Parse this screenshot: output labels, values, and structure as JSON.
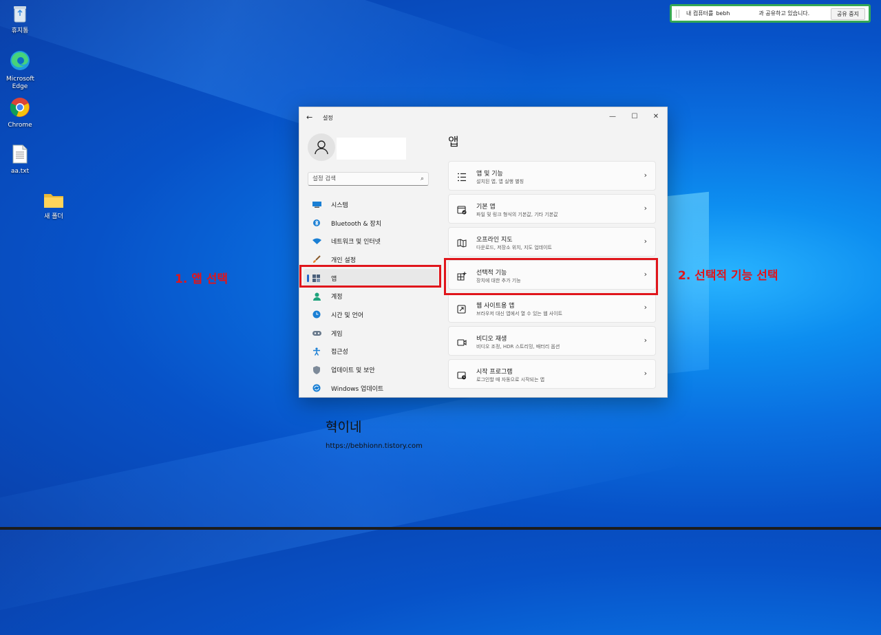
{
  "desktop": {
    "icons": [
      {
        "label": "휴지통",
        "icon": "recycle-bin-icon"
      },
      {
        "label": "Microsoft Edge",
        "icon": "edge-icon"
      },
      {
        "label": "Chrome",
        "icon": "chrome-icon"
      },
      {
        "label": "aa.txt",
        "icon": "text-file-icon"
      },
      {
        "label": "새 폴더",
        "icon": "folder-icon"
      }
    ]
  },
  "share_bar": {
    "prefix": "내 컴퓨터를",
    "user": "bebh",
    "suffix": "과 공유하고 있습니다.",
    "stop_label": "공유 중지"
  },
  "settings": {
    "window_title": "설정",
    "search_placeholder": "설정 검색",
    "nav": [
      {
        "label": "시스템",
        "icon": "monitor-icon"
      },
      {
        "label": "Bluetooth & 장치",
        "icon": "bluetooth-icon"
      },
      {
        "label": "네트워크 및 인터넷",
        "icon": "wifi-icon"
      },
      {
        "label": "개인 설정",
        "icon": "brush-icon"
      },
      {
        "label": "앱",
        "icon": "apps-icon"
      },
      {
        "label": "계정",
        "icon": "person-icon"
      },
      {
        "label": "시간 및 언어",
        "icon": "globe-clock-icon"
      },
      {
        "label": "게임",
        "icon": "gamepad-icon"
      },
      {
        "label": "접근성",
        "icon": "accessibility-icon"
      },
      {
        "label": "업데이트 및 보안",
        "icon": "shield-icon"
      },
      {
        "label": "Windows 업데이트",
        "icon": "update-icon"
      }
    ],
    "page_title": "앱",
    "cards": [
      {
        "title": "앱 및 기능",
        "subtitle": "설치된 앱, 앱 실행 별칭",
        "icon": "app-list-icon"
      },
      {
        "title": "기본 앱",
        "subtitle": "파일 및 링크 형식의 기본값, 기타 기본값",
        "icon": "default-apps-icon"
      },
      {
        "title": "오프라인 지도",
        "subtitle": "다운로드, 저장소 위치, 지도 업데이트",
        "icon": "map-icon"
      },
      {
        "title": "선택적 기능",
        "subtitle": "장치에 대한 추가 기능",
        "icon": "add-feature-icon"
      },
      {
        "title": "웹 사이트용 앱",
        "subtitle": "브라우저 대신 앱에서 열 수 있는 웹 사이트",
        "icon": "web-app-icon"
      },
      {
        "title": "비디오 재생",
        "subtitle": "비디오 조정, HDR 스트리밍, 배터리 옵션",
        "icon": "video-icon"
      },
      {
        "title": "시작 프로그램",
        "subtitle": "로그인할 때 자동으로 시작되는 앱",
        "icon": "startup-icon"
      }
    ]
  },
  "annotations": {
    "step1": "1. 앱 선택",
    "step2": "2. 선택적 기능 선택",
    "color": "#e0151b"
  },
  "watermark": {
    "name": "혁이네",
    "url": "https://bebhionn.tistory.com"
  }
}
